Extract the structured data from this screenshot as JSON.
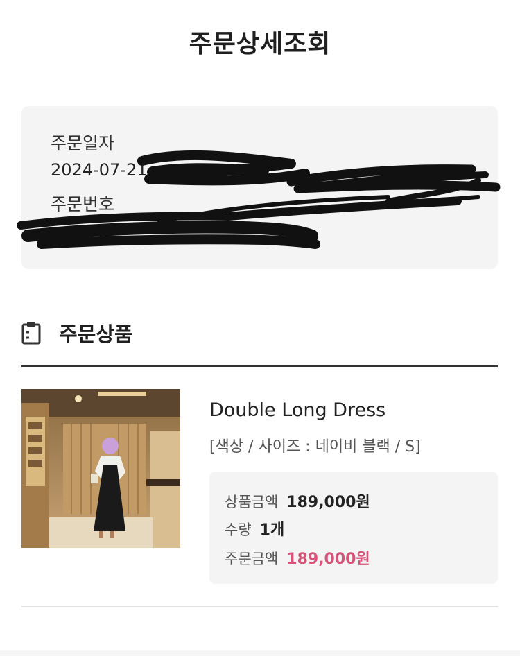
{
  "page": {
    "title": "주문상세조회"
  },
  "order_info": {
    "date_label": "주문일자",
    "date_value": "2024-07-21",
    "number_label": "주문번호",
    "number_value": ""
  },
  "section": {
    "title": "주문상품",
    "icon": "clipboard-icon"
  },
  "product": {
    "name": "Double Long Dress",
    "options": "[색상 / 사이즈 : 네이비 블랙 / S]",
    "price_label": "상품금액",
    "price_value": "189,000원",
    "qty_label": "수량",
    "qty_value": "1개",
    "order_amount_label": "주문금액",
    "order_amount_value": "189,000원"
  },
  "colors": {
    "accent": "#d6547a",
    "box_bg": "#f4f4f4",
    "scribble": "#111111"
  }
}
